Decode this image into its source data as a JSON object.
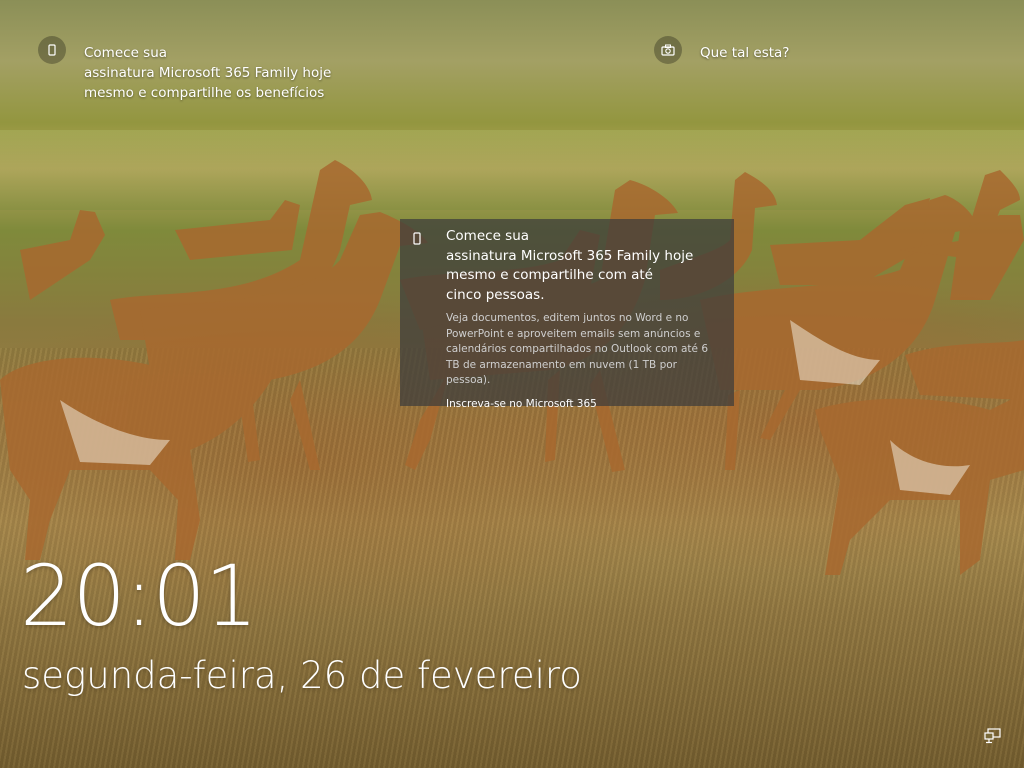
{
  "lockscreen": {
    "notice_left": {
      "icon": "phone-icon",
      "lines": [
        "Comece sua",
        "assinatura Microsoft 365 Family hoje",
        "mesmo e compartilhe os benefícios"
      ]
    },
    "notice_right": {
      "icon": "camera-icon",
      "label": "Que tal esta?"
    },
    "flyout": {
      "icon": "phone-icon",
      "title_lines": [
        "Comece sua",
        "assinatura Microsoft 365 Family hoje",
        "mesmo e compartilhe com até",
        "cinco pessoas."
      ],
      "body_lines": [
        "Veja documentos, editem juntos no Word e no",
        "PowerPoint e aproveitem emails sem anúncios e",
        "calendários compartilhados no Outlook com até 6",
        "TB de armazenamento em nuvem (1 TB por pessoa)."
      ],
      "link": "Inscreva-se no Microsoft 365"
    },
    "clock": "20:01",
    "date": "segunda-feira, 26 de fevereiro",
    "status_icons": [
      "network-icon"
    ]
  }
}
